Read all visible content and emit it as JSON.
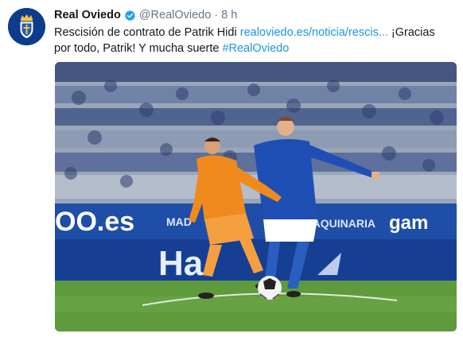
{
  "tweet": {
    "display_name": "Real Oviedo",
    "handle": "@RealOviedo",
    "separator": "·",
    "time": "8 h",
    "text_before_link": "Rescisión de contrato de Patrik Hidi ",
    "link": "realoviedo.es/noticia/rescis...",
    "text_after_link": " ¡Gracias por todo, Patrik! Y mucha suerte ",
    "hashtag": "#RealOviedo"
  },
  "photo": {
    "ad_texts": [
      "OO.es",
      "MAD",
      "MAQUINARIA",
      "gam",
      "Ha"
    ],
    "colors": {
      "stand": "#9aa6b8",
      "ad_board": "#1f4ea8",
      "pitch": "#5f9a3c",
      "orange_kit": "#f08a1c",
      "blue_kit": "#1f4fb5"
    }
  },
  "icons": {
    "avatar": "real-oviedo-crest-icon",
    "verified": "verified-badge-icon"
  },
  "colors": {
    "link": "#1b95e0",
    "text": "#14171a",
    "muted": "#657786"
  }
}
